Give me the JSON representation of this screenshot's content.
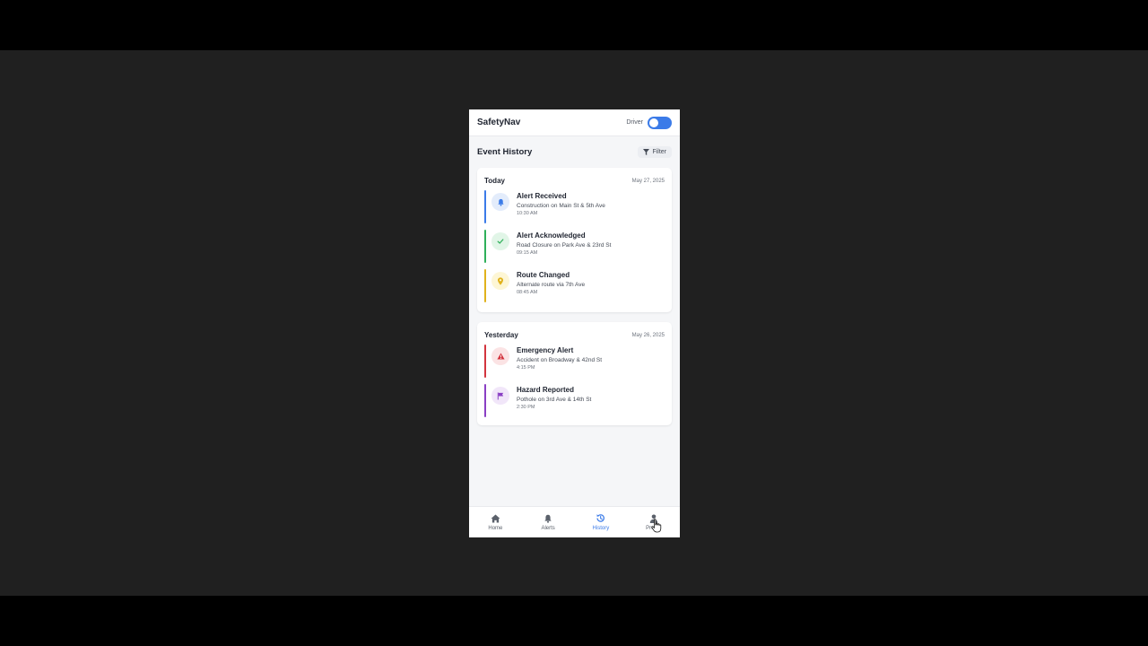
{
  "app": {
    "title": "SafetyNav",
    "mode_label": "Driver"
  },
  "page": {
    "title": "Event History",
    "filter_label": "Filter"
  },
  "groups": [
    {
      "day": "Today",
      "date": "May 27, 2025",
      "events": [
        {
          "title": "Alert Received",
          "desc": "Construction on Main St & 5th Ave",
          "time": "10:30 AM",
          "icon": "bell-icon",
          "color": "#3b7be8",
          "bg": "#e3ecfb"
        },
        {
          "title": "Alert Acknowledged",
          "desc": "Road Closure on Park Ave & 23rd St",
          "time": "09:15 AM",
          "icon": "check-icon",
          "color": "#2fb05a",
          "bg": "#e1f5e7"
        },
        {
          "title": "Route Changed",
          "desc": "Alternate route via 7th Ave",
          "time": "08:45 AM",
          "icon": "location-pin-icon",
          "color": "#e0b21c",
          "bg": "#fdf6d5"
        }
      ]
    },
    {
      "day": "Yesterday",
      "date": "May 26, 2025",
      "events": [
        {
          "title": "Emergency Alert",
          "desc": "Accident on Broadway & 42nd St",
          "time": "4:15 PM",
          "icon": "warning-icon",
          "color": "#d3343e",
          "bg": "#fbe3e4"
        },
        {
          "title": "Hazard Reported",
          "desc": "Pothole on 3rd Ave & 14th St",
          "time": "2:30 PM",
          "icon": "flag-icon",
          "color": "#8a3fc4",
          "bg": "#f1e6f9"
        }
      ]
    }
  ],
  "nav": [
    {
      "label": "Home",
      "icon": "home-icon",
      "active": false
    },
    {
      "label": "Alerts",
      "icon": "bell-icon",
      "active": false
    },
    {
      "label": "History",
      "icon": "history-icon",
      "active": true
    },
    {
      "label": "Profile",
      "icon": "user-icon",
      "active": false
    }
  ],
  "colors": {
    "accent": "#3b7be8",
    "backdrop": "#202020"
  }
}
